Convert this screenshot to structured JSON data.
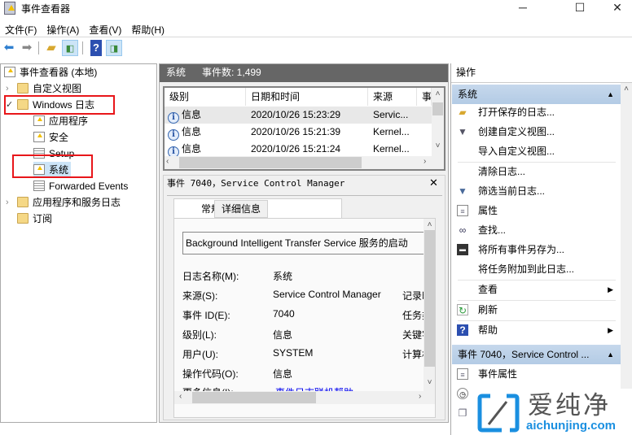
{
  "window": {
    "title": "事件查看器",
    "controls": {
      "minimize": "─",
      "maximize": "☐",
      "close": "✕"
    }
  },
  "menu": [
    "文件(F)",
    "操作(A)",
    "查看(V)",
    "帮助(H)"
  ],
  "toolbar": {
    "icons": [
      "back-arrow-icon",
      "forward-arrow-icon",
      "folder-up-icon",
      "show-hide-tree-icon",
      "help-icon",
      "show-hide-action-pane-icon"
    ]
  },
  "tree": {
    "root": "事件查看器 (本地)",
    "custom_views": "自定义视图",
    "windows_logs": "Windows 日志",
    "logs": [
      "应用程序",
      "安全",
      "Setup",
      "系统",
      "Forwarded Events"
    ],
    "app_service_logs": "应用程序和服务日志",
    "subscriptions": "订阅",
    "selected": "系统"
  },
  "middle": {
    "header": {
      "log": "系统",
      "count": "事件数: 1,499"
    },
    "columns": [
      "级别",
      "日期和时间",
      "来源",
      "事"
    ],
    "rows": [
      {
        "level": "信息",
        "datetime": "2020/10/26 15:23:29",
        "source": "Servic..."
      },
      {
        "level": "信息",
        "datetime": "2020/10/26 15:21:39",
        "source": "Kernel..."
      },
      {
        "level": "信息",
        "datetime": "2020/10/26 15:21:24",
        "source": "Kernel..."
      }
    ],
    "detail": {
      "title": "事件 7040，Service Control Manager",
      "close": "✕",
      "tabs": [
        "常规",
        "详细信息"
      ],
      "description": "Background Intelligent Transfer Service 服务的启动",
      "fields": [
        {
          "label": "日志名称(M):",
          "value": "系统",
          "extra": ""
        },
        {
          "label": "来源(S):",
          "value": "Service Control Manager",
          "extra": "记录时"
        },
        {
          "label": "事件 ID(E):",
          "value": "7040",
          "extra": "任务类"
        },
        {
          "label": "级别(L):",
          "value": "信息",
          "extra": "关键字"
        },
        {
          "label": "用户(U):",
          "value": "SYSTEM",
          "extra": "计算机"
        },
        {
          "label": "操作代码(O):",
          "value": "信息",
          "extra": ""
        },
        {
          "label": "更多信息(I):",
          "value": "事件日志联机帮助",
          "extra": ""
        }
      ]
    }
  },
  "actions": {
    "header": "操作",
    "section1": "系统",
    "items": [
      {
        "label": "打开保存的日志...",
        "icon": "open-folder-icon"
      },
      {
        "label": "创建自定义视图...",
        "icon": "filter-star-icon"
      },
      {
        "label": "导入自定义视图...",
        "icon": ""
      },
      {
        "label": "清除日志...",
        "icon": ""
      },
      {
        "label": "筛选当前日志...",
        "icon": "filter-icon"
      },
      {
        "label": "属性",
        "icon": "properties-icon"
      },
      {
        "label": "查找...",
        "icon": "binoculars-icon"
      },
      {
        "label": "将所有事件另存为...",
        "icon": "save-icon"
      },
      {
        "label": "将任务附加到此日志...",
        "icon": ""
      },
      {
        "label": "查看",
        "icon": "",
        "submenu": true
      },
      {
        "label": "刷新",
        "icon": "refresh-icon"
      },
      {
        "label": "帮助",
        "icon": "help-icon",
        "submenu": true
      }
    ],
    "section2": "事件 7040，Service Control ...",
    "items2": [
      {
        "label": "事件属性",
        "icon": "properties-icon"
      }
    ]
  },
  "watermark": {
    "brand": "爱纯净",
    "site": "aichunjing.com"
  },
  "colors": {
    "selection_box": "#e8161a",
    "section_header": "#c6d8ec",
    "pane_header": "#666666",
    "link": "#0000ee"
  }
}
